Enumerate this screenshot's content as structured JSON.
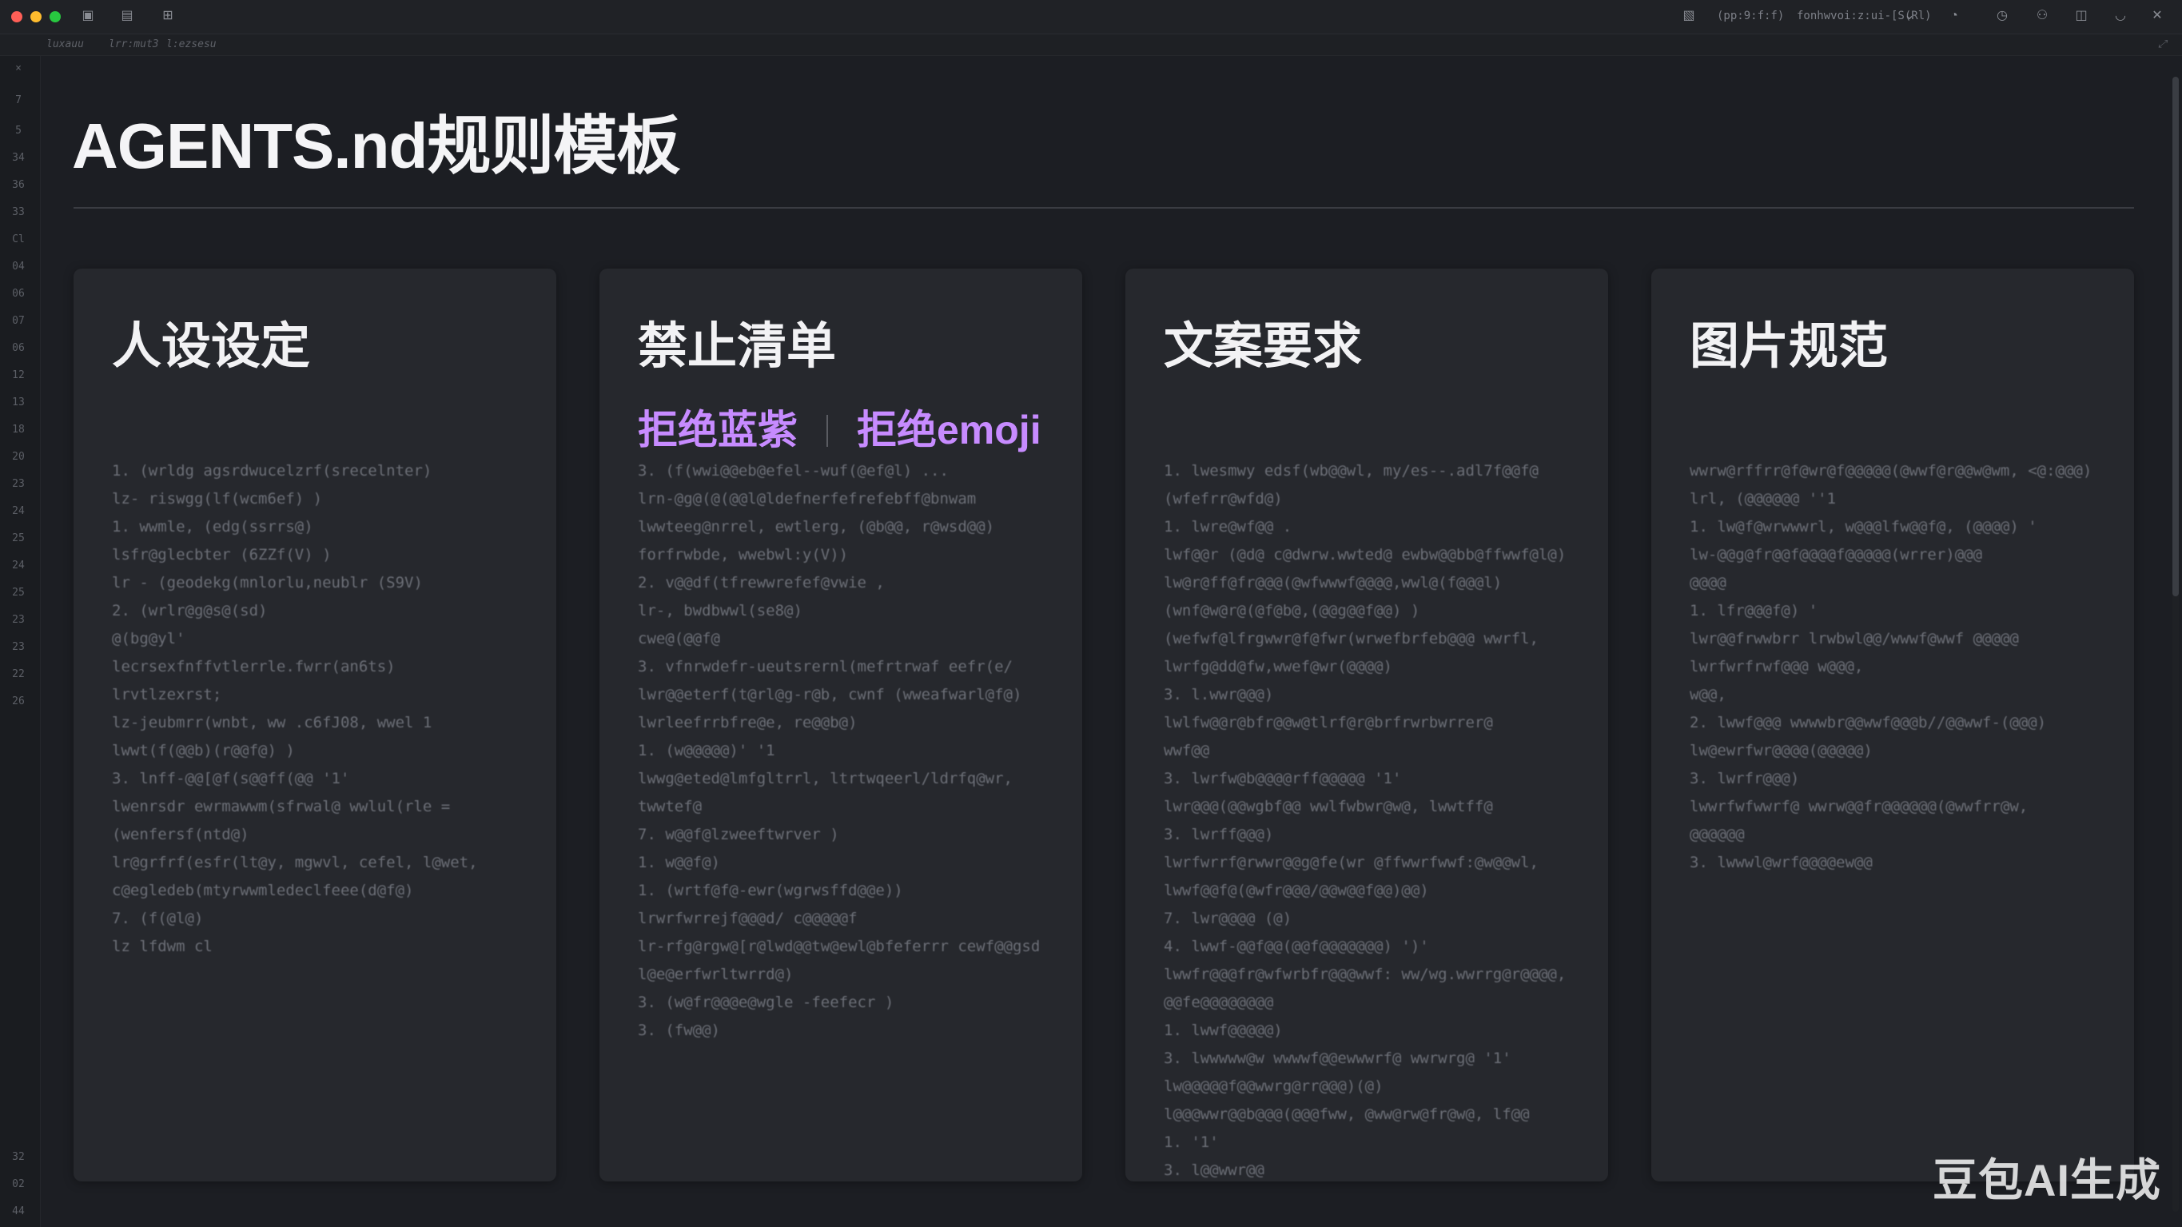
{
  "window": {
    "toolbar_texts": [
      "(pp:9:f:f)",
      "fonhwvoi:z:ui-[S(Rl)"
    ],
    "icons": [
      "window-icon",
      "sidebar-icon",
      "layout-icon",
      "bell-icon",
      "clock-icon",
      "person-icon",
      "split-icon",
      "account-icon"
    ]
  },
  "breadcrumb": [
    "luxauu",
    "lrr:mut3",
    "l:ezsesu"
  ],
  "gutter": {
    "top": [
      "×",
      "7",
      "5",
      "34",
      "36",
      "33",
      "Cl",
      "04",
      "06",
      "07",
      "06",
      "12",
      "13",
      "18",
      "20",
      "23",
      "24",
      "25",
      "24",
      "25",
      "23",
      "23",
      "22",
      "26"
    ],
    "bottom": [
      "32",
      "02",
      "44"
    ]
  },
  "document": {
    "title": "AGENTS.nd规则模板"
  },
  "cards": [
    {
      "title": "人设设定",
      "lines": [
        "1. (wrldg agsrdwucelzrf(srecelnter)",
        "   lz- riswgg(lf(wcm6ef) )",
        "1. wwmle, (edg(ssrrs@)",
        "   lsfr@glecbter  (6ZZf(V)  )",
        "   lr - (geodekg(mnlorlu,neublr  (S9V)",
        "2. (wrlr@g@s@(sd)",
        "   @(bg@yl'",
        "   lecrsexfnffvtlerrle.fwrr(an6ts)",
        "   lrvtlzexrst;",
        "   lz-jeubmrr(wnbt, ww .c6fJ08, wwel  1",
        "   lwwt(f(@@b)(r@@f@)  )",
        "3. lnff-@@[@f(s@@ff(@@  '1'",
        "   lwenrsdr ewrmawwm(sfrwal@ wwlul(rle =",
        "   (wenfersf(ntd@)",
        "   lr@grfrf(esfr(lt@y, mgwvl, cefel, l@wet,",
        "   c@egledeb(mtyrwwmledeclfeee(d@f@)",
        "7. (f(@l@)",
        "lz lfdwm cl"
      ]
    },
    {
      "title": "禁止清单",
      "tags": [
        "拒绝蓝紫",
        "拒绝emoji"
      ],
      "lines": [
        "3. (f(wwi@@eb@efel--wuf(@ef@l)    ...",
        "   lrn-@g@(@(@@l@ldefnerfefrefebff@bnwam",
        "   lwwteeg@nrrel, ewtlerg,  (@b@@, r@wsd@@)",
        "   forfrwbde, wwebwl:y(V))",
        "2. v@@df(tfrewwrefef@vwie  ,",
        "   lr-, bwdbwwl(se8@)",
        "   cwe@(@@f@",
        "3. vfnrwdefr-ueutsrernl(mefrtrwaf  eefr(e/",
        "   lwr@@eterf(t@rl@g-r@b, cwnf (wweafwarl@f@)",
        "   lwrleefrrbfre@e, re@@b@)",
        "1. (w@@@@@)'  '1",
        "   lwwg@eted@lmfgltrrl, ltrtwqeerl/ldrfq@wr,",
        "   twwtef@",
        "7. w@@f@lzweeftwrver  )",
        "1. w@@f@)",
        "1. (wrtf@f@-ewr(wgrwsffd@@e))",
        "   lrwrfwrrejf@@@d/  c@@@@@f",
        "   lr-rfg@rgw@[r@lwd@@tw@ewl@bfeferrr  cewf@@gsd",
        "   l@e@erfwrltwrrd@)",
        "3. (w@fr@@@e@wgle  -feefecr  )",
        "3. (fw@@)"
      ]
    },
    {
      "title": "文案要求",
      "lines": [
        "1. lwesmwy edsf(wb@@wl, my/es--.adl7f@@f@",
        "   (wfefrr@wfd@)",
        "1. lwre@wf@@     .",
        "   lwf@@r (@d@ c@dwrw.wwted@ ewbw@@bb@ffwwf@l@)",
        "   lw@r@ff@fr@@@(@wfwwwf@@@@,wwl@(f@@@l)",
        "   (wnf@w@r@(@f@b@,(@@g@@f@@)  )",
        "   (wefwf@lfrgwwr@f@fwr(wrwefbrfeb@@@ wwrfl,",
        "   lwrfg@dd@fw,wwef@wr(@@@@)",
        "3. l.wwr@@@)",
        "   lwlfw@@r@bfr@@w@tlrf@r@brfrwrbwrrer@",
        "   wwf@@",
        "3. lwrfw@b@@@@rff@@@@@  '1'",
        "   lwr@@@(@@wgbf@@ wwlfwbwr@w@, lwwtff@",
        "3. lwrff@@@)",
        "   lwrfwrrf@rwwr@@g@fe(wr  @ffwwrfwwf:@w@@wl,",
        "   lwwf@@f@(@wfr@@@/@@w@@f@@)@@)",
        "7. lwr@@@@  (@)",
        "4. lwwf-@@f@@(@@f@@@@@@@)  ')'",
        "   lwwfr@@@fr@wfwrbfr@@@wwf: ww/wg.wwrrg@r@@@@,",
        "   @@fe@@@@@@@@",
        "1. lwwf@@@@@)",
        "3. lwwwww@w wwwwf@@ewwwrf@ wwrwrg@  '1'",
        "   lw@@@@@f@@wwrg@rr@@@)(@)",
        "   l@@@wwr@@b@@@(@@@fww, @ww@rw@fr@w@, lf@@",
        "1.  '1'",
        "3. l@@wwr@@"
      ]
    },
    {
      "title": "图片规范",
      "lines": [
        "wwrw@rffrr@f@wr@f@@@@@(@wwf@r@@w@wm, <@:@@@)",
        "lrl, (@@@@@@  ''1",
        "1. lw@f@wrwwwrl, w@@@lfw@@f@, (@@@@)  '",
        "   lw-@@g@fr@@f@@@@f@@@@@(wrrer)@@@",
        "   @@@@",
        "1. lfr@@@f@)   '",
        "   lwr@@frwwbrr lrwbwl@@/wwwf@wwf  @@@@@",
        "   lwrfwrfrwf@@@  w@@@,",
        "   w@@,",
        "2. lwwf@@@  wwwwbr@@wwf@@@b//@@wwf-(@@@)",
        "   lw@ewrfwr@@@@(@@@@@)",
        "3. lwrfr@@@)",
        "   lwwrfwfwwrf@  wwrw@@fr@@@@@@(@wwfrr@w,",
        "   @@@@@@",
        "3. lwwwl@wrf@@@@ew@@"
      ]
    }
  ],
  "watermark": "豆包AI生成"
}
